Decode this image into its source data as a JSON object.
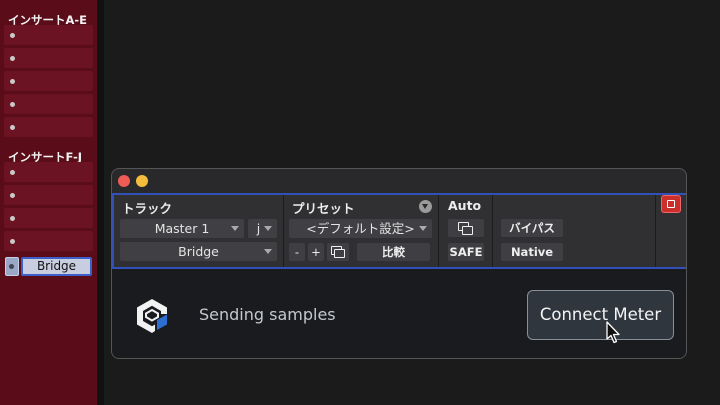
{
  "inserts": {
    "header_ae": "インサートA-E",
    "header_fj": "インサートF-J",
    "active_insert": "Bridge"
  },
  "plugin": {
    "track_label": "トラック",
    "preset_label": "プリセット",
    "auto_label": "Auto",
    "track_name": "Master 1",
    "track_channel": "j",
    "insert_name": "Bridge",
    "preset_name": "<デフォルト設定>",
    "minus_label": "-",
    "plus_label": "+",
    "compare_label": "比較",
    "safe_label": "SAFE",
    "bypass_label": "バイパス",
    "native_label": "Native"
  },
  "body": {
    "status": "Sending samples",
    "connect_label": "Connect Meter"
  },
  "colors": {
    "insert_panel": "#5a0d19",
    "accent_blue": "#3150b8",
    "close_red": "#c9302c"
  }
}
